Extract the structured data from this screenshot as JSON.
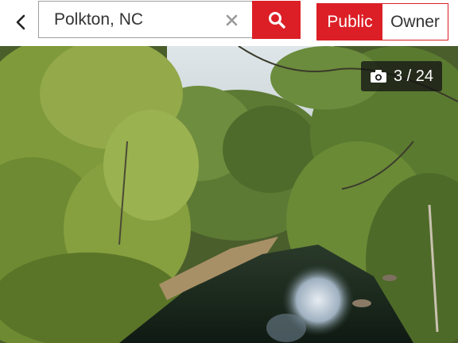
{
  "search": {
    "value": "Polkton, NC",
    "clear_glyph": "×"
  },
  "icons": {
    "back": "chevron-left-icon",
    "search": "magnifier-icon",
    "clear": "close-icon",
    "camera": "camera-icon"
  },
  "toggle": {
    "options": [
      "Public",
      "Owner"
    ],
    "selected": "Public"
  },
  "photo": {
    "current": 3,
    "total": 24,
    "counter_text": "3 / 24"
  },
  "colors": {
    "accent": "#dc1f26",
    "counter_bg": "#141414"
  }
}
